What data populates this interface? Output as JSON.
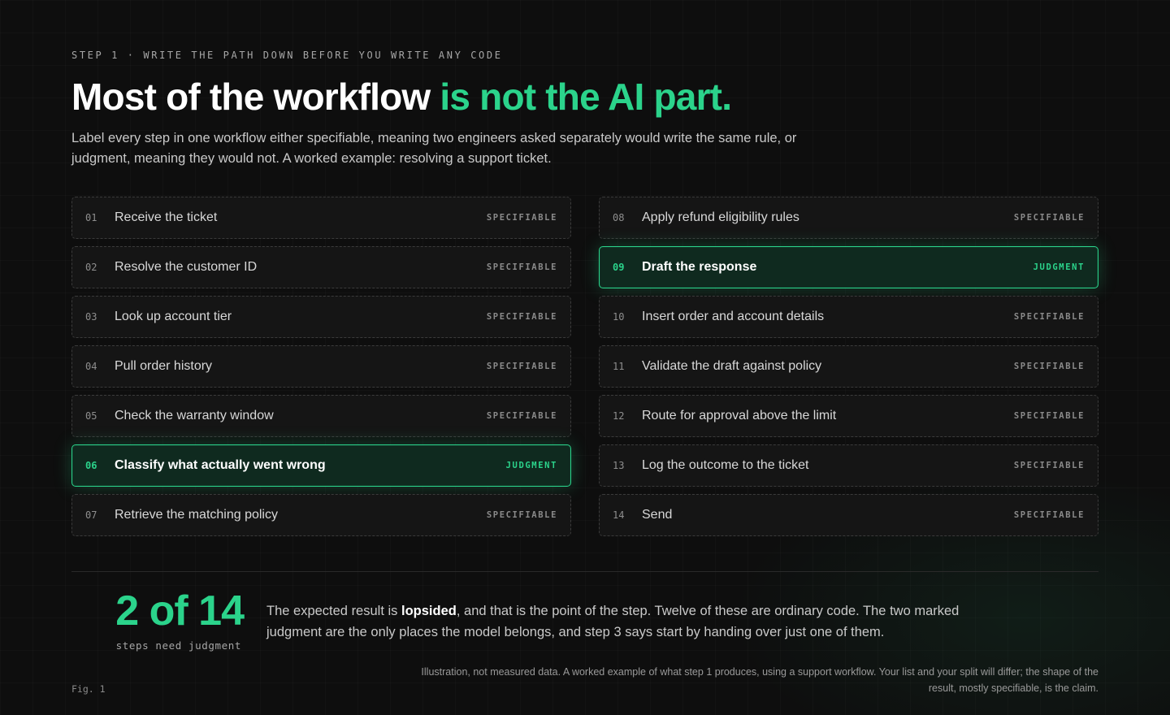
{
  "eyebrow": "STEP 1 · WRITE THE PATH DOWN BEFORE YOU WRITE ANY CODE",
  "headline": {
    "plain": "Most of the workflow ",
    "accent": "is not the AI part."
  },
  "lede": "Label every step in one workflow either specifiable, meaning two engineers asked separately would write the same rule, or judgment, meaning they would not. A worked example: resolving a support ticket.",
  "accent_color": "#2bd38b",
  "steps": [
    {
      "num": "01",
      "label": "Receive the ticket",
      "tag": "SPECIFIABLE",
      "kind": "specifiable"
    },
    {
      "num": "02",
      "label": "Resolve the customer ID",
      "tag": "SPECIFIABLE",
      "kind": "specifiable"
    },
    {
      "num": "03",
      "label": "Look up account tier",
      "tag": "SPECIFIABLE",
      "kind": "specifiable"
    },
    {
      "num": "04",
      "label": "Pull order history",
      "tag": "SPECIFIABLE",
      "kind": "specifiable"
    },
    {
      "num": "05",
      "label": "Check the warranty window",
      "tag": "SPECIFIABLE",
      "kind": "specifiable"
    },
    {
      "num": "06",
      "label": "Classify what actually went wrong",
      "tag": "JUDGMENT",
      "kind": "judgment"
    },
    {
      "num": "07",
      "label": "Retrieve the matching policy",
      "tag": "SPECIFIABLE",
      "kind": "specifiable"
    },
    {
      "num": "08",
      "label": "Apply refund eligibility rules",
      "tag": "SPECIFIABLE",
      "kind": "specifiable"
    },
    {
      "num": "09",
      "label": "Draft the response",
      "tag": "JUDGMENT",
      "kind": "judgment"
    },
    {
      "num": "10",
      "label": "Insert order and account details",
      "tag": "SPECIFIABLE",
      "kind": "specifiable"
    },
    {
      "num": "11",
      "label": "Validate the draft against policy",
      "tag": "SPECIFIABLE",
      "kind": "specifiable"
    },
    {
      "num": "12",
      "label": "Route for approval above the limit",
      "tag": "SPECIFIABLE",
      "kind": "specifiable"
    },
    {
      "num": "13",
      "label": "Log the outcome to the ticket",
      "tag": "SPECIFIABLE",
      "kind": "specifiable"
    },
    {
      "num": "14",
      "label": "Send",
      "tag": "SPECIFIABLE",
      "kind": "specifiable"
    }
  ],
  "stat": {
    "value": "2 of 14",
    "caption": "steps need judgment"
  },
  "summary": {
    "before": "The expected result is ",
    "emphasis": "lopsided",
    "after": ", and that is the point of the step. Twelve of these are ordinary code. The two marked judgment are the only places the model belongs, and step 3 says start by handing over just one of them."
  },
  "figure_label": "Fig. 1",
  "footnote": "Illustration, not measured data. A worked example of what step 1 produces, using a support workflow. Your list and your split will differ; the shape of the result, mostly specifiable, is the claim."
}
